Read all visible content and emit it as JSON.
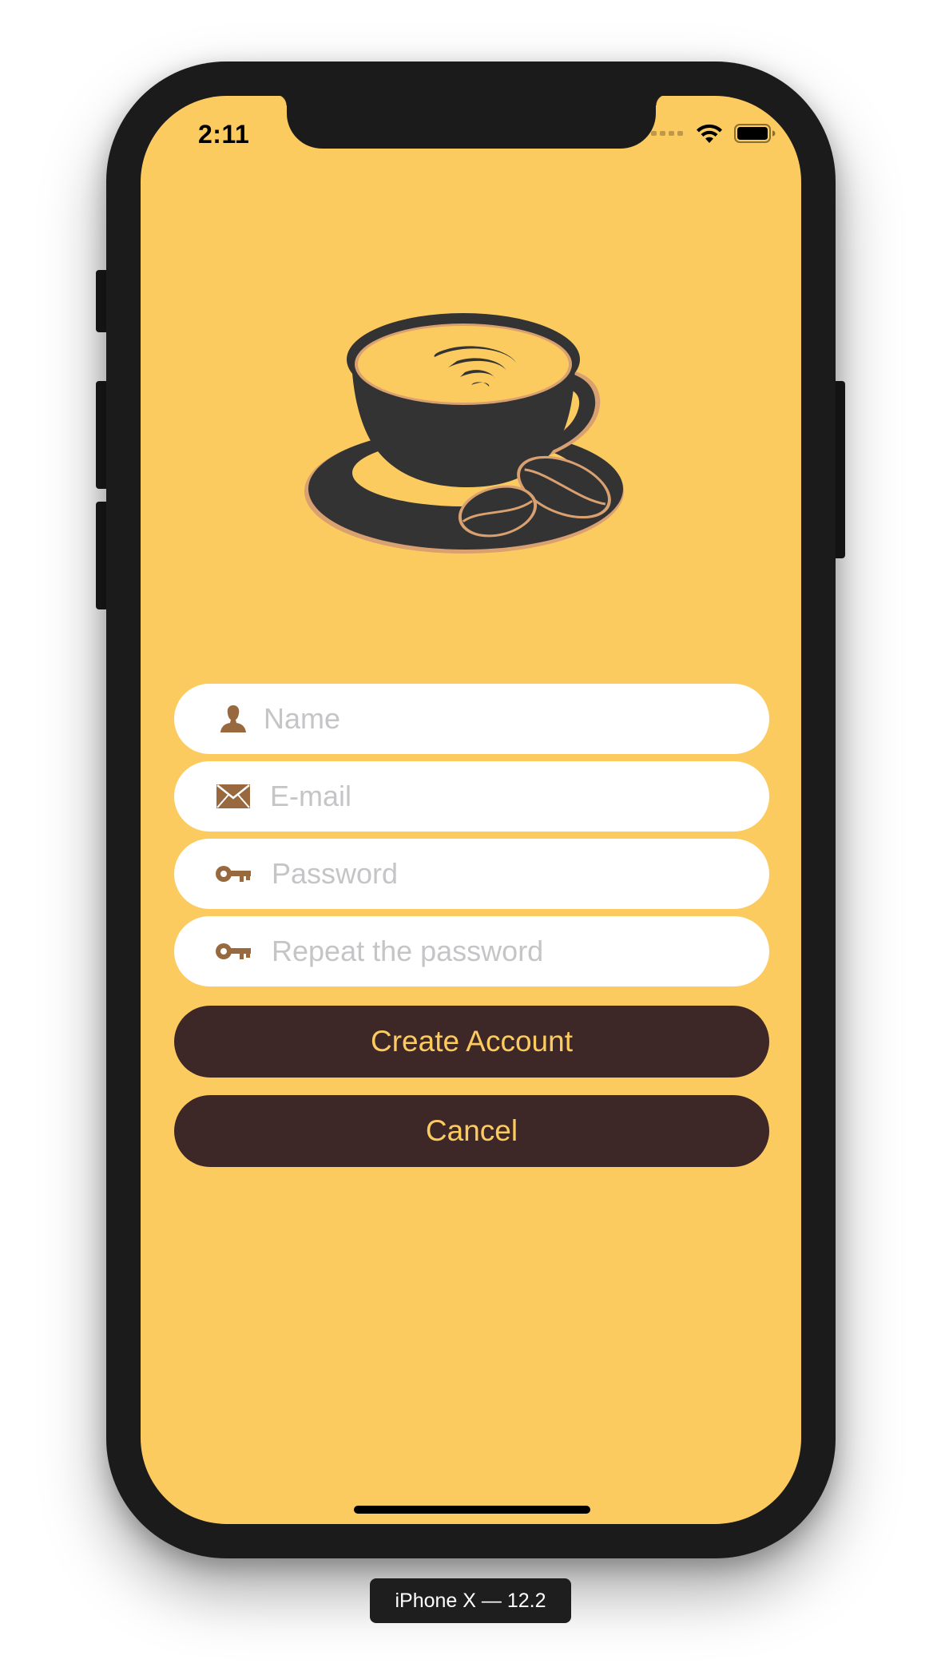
{
  "status_bar": {
    "time": "2:11",
    "icons": [
      "signal-dots-icon",
      "wifi-icon",
      "battery-icon"
    ]
  },
  "logo": {
    "icon": "coffee-cup-with-beans-icon"
  },
  "form": {
    "name": {
      "placeholder": "Name",
      "value": "",
      "icon": "person-icon"
    },
    "email": {
      "placeholder": "E-mail",
      "value": "",
      "icon": "envelope-icon"
    },
    "password": {
      "placeholder": "Password",
      "value": "",
      "icon": "key-icon"
    },
    "repeat_password": {
      "placeholder": "Repeat the password",
      "value": "",
      "icon": "key-icon"
    }
  },
  "buttons": {
    "create_account": "Create Account",
    "cancel": "Cancel"
  },
  "device_label": "iPhone X — 12.2",
  "colors": {
    "background": "#fccb60",
    "button": "#3e2727",
    "button_text": "#fccb60",
    "icon_accent": "#98683f",
    "logo_dark": "#333333",
    "logo_outline": "#d9a070"
  }
}
